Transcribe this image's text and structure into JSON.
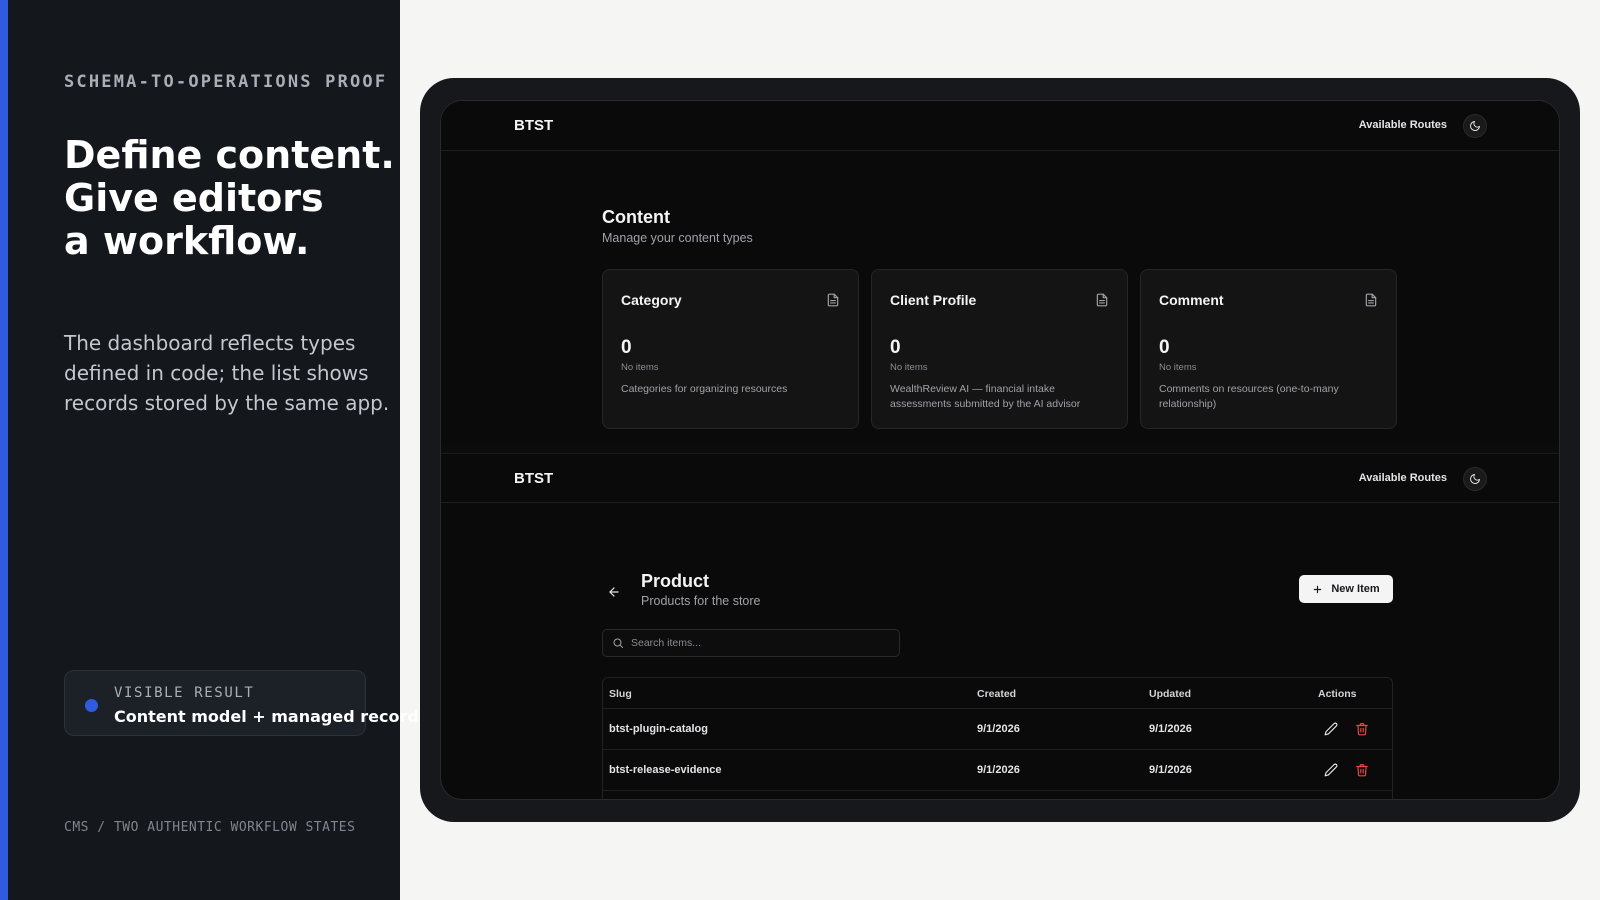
{
  "left": {
    "eyebrow": "SCHEMA-TO-OPERATIONS PROOF",
    "headline": [
      "Define content.",
      "Give editors",
      "a workflow."
    ],
    "description": "The dashboard reflects types defined in code; the list shows records stored by the same app.",
    "result_label": "VISIBLE RESULT",
    "result_value": "Content model + managed records",
    "footer": "CMS / TWO AUTHENTIC WORKFLOW STATES"
  },
  "colors": {
    "accent": "#2f5be0",
    "danger": "#ef4444"
  },
  "top_app": {
    "brand": "BTST",
    "routes_link": "Available Routes",
    "theme_icon": "moon-icon",
    "title": "Content",
    "subtitle": "Manage your content types",
    "cards": [
      {
        "title": "Category",
        "icon": "file-text-icon",
        "count": "0",
        "count_label": "No items",
        "description": "Categories for organizing resources"
      },
      {
        "title": "Client Profile",
        "icon": "file-text-icon",
        "count": "0",
        "count_label": "No items",
        "description": "WealthReview AI — financial intake assessments submitted by the AI advisor"
      },
      {
        "title": "Comment",
        "icon": "file-text-icon",
        "count": "0",
        "count_label": "No items",
        "description": "Comments on resources (one-to-many relationship)"
      }
    ]
  },
  "bottom_app": {
    "brand": "BTST",
    "routes_link": "Available Routes",
    "theme_icon": "moon-icon",
    "title": "Product",
    "subtitle": "Products for the store",
    "new_button": "New Item",
    "search_placeholder": "Search items...",
    "table": {
      "headers": [
        "Slug",
        "Created",
        "Updated",
        "Actions"
      ],
      "rows": [
        {
          "slug": "btst-plugin-catalog",
          "created": "9/1/2026",
          "updated": "9/1/2026"
        },
        {
          "slug": "btst-release-evidence",
          "created": "9/1/2026",
          "updated": "9/1/2026"
        }
      ]
    }
  }
}
